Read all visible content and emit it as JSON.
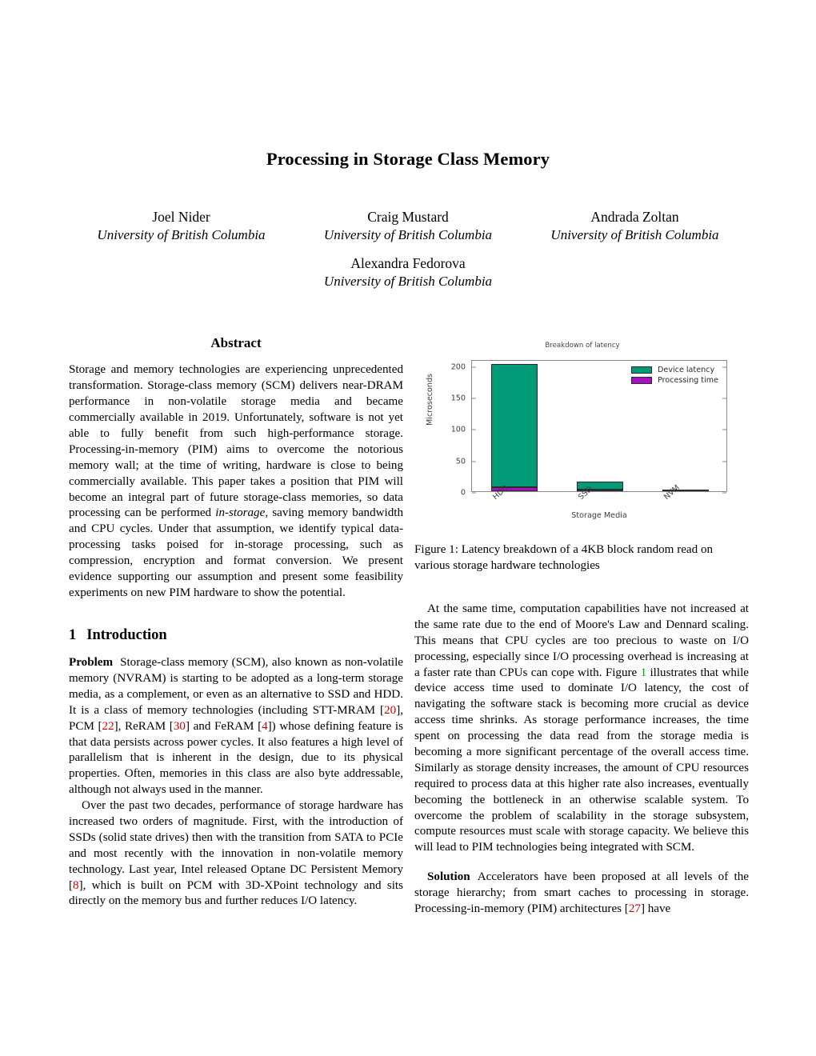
{
  "paper": {
    "title": "Processing in Storage Class Memory",
    "authors": [
      {
        "name": "Joel Nider",
        "affiliation": "University of British Columbia"
      },
      {
        "name": "Craig Mustard",
        "affiliation": "University of British Columbia"
      },
      {
        "name": "Andrada Zoltan",
        "affiliation": "University of British Columbia"
      },
      {
        "name": "Alexandra Fedorova",
        "affiliation": "University of British Columbia"
      }
    ]
  },
  "abstract": {
    "heading": "Abstract",
    "text_part1": "Storage and memory technologies are experiencing unprecedented transformation. Storage-class memory (SCM) delivers near-DRAM performance in non-volatile storage media and became commercially available in 2019. Unfortunately, software is not yet able to fully benefit from such high-performance storage. Processing-in-memory (PIM) aims to overcome the notorious memory wall; at the time of writing, hardware is close to being commercially available. This paper takes a position that PIM will become an integral part of future storage-class memories, so data processing can be performed ",
    "emphasis": "in-storage",
    "text_part2": ", saving memory bandwidth and CPU cycles. Under that assumption, we identify typical data-processing tasks poised for in-storage processing, such as compression, encryption and format conversion. We present evidence supporting our assumption and present some feasibility experiments on new PIM hardware to show the potential."
  },
  "introduction": {
    "number": "1",
    "heading": "Introduction",
    "problem": {
      "runin": "Problem",
      "t1": "Storage-class memory (SCM), also known as non-volatile memory (NVRAM) is starting to be adopted as a long-term storage media, as a complement, or even as an alternative to SSD and HDD. It is a class of memory technologies (including STT-MRAM [",
      "c1": "20",
      "t2": "], PCM [",
      "c2": "22",
      "t3": "], ReRAM [",
      "c3": "30",
      "t4": "] and FeRAM [",
      "c4": "4",
      "t5": "]) whose defining feature is that data persists across power cycles. It also features a high level of parallelism that is inherent in the design, due to its physical properties. Often, memories in this class are also byte addressable, although not always used in the manner."
    },
    "paragraph2": {
      "t1": "Over the past two decades, performance of storage hardware has increased two orders of magnitude. First, with the introduction of SSDs (solid state drives) then with the transition from SATA to PCIe and most recently with the innovation in non-volatile memory technology. Last year, Intel released Optane DC Persistent Memory [",
      "c1": "8",
      "t2": "], which is built on PCM with 3D-XPoint technology and sits directly on the memory bus and further reduces I/O latency."
    }
  },
  "right_column": {
    "figure_caption": "Figure 1: Latency breakdown of a 4KB block random read on various storage hardware technologies",
    "paragraph1": {
      "t1": "At the same time, computation capabilities have not increased at the same rate due to the end of Moore's Law and Dennard scaling. This means that CPU cycles are too precious to waste on I/O processing, especially since I/O processing overhead is increasing at a faster rate than CPUs can cope with. Figure ",
      "ref": "1",
      "t2": " illustrates that while device access time used to dominate I/O latency, the cost of navigating the software stack is becoming more crucial as device access time shrinks. As storage performance increases, the time spent on processing the data read from the storage media is becoming a more significant percentage of the overall access time. Similarly as storage density increases, the amount of CPU resources required to process data at this higher rate also increases, eventually becoming the bottleneck in an otherwise scalable system. To overcome the problem of scalability in the storage subsystem, compute resources must scale with storage capacity. We believe this will lead to PIM technologies being integrated with SCM."
    },
    "solution": {
      "runin": "Solution",
      "t1": "Accelerators have been proposed at all levels of the storage hierarchy; from smart caches to processing in storage. Processing-in-memory (PIM) architectures [",
      "c1": "27",
      "t2": "] have"
    }
  },
  "chart_data": {
    "type": "bar",
    "title": "Breakdown of latency",
    "xlabel": "Storage Media",
    "ylabel": "Microseconds",
    "categories": [
      "HDD",
      "SSD",
      "NVM"
    ],
    "ylim": [
      0,
      210
    ],
    "yticks": [
      0,
      50,
      100,
      150,
      200
    ],
    "ytick_labels": [
      "0",
      "50",
      "100",
      "150",
      "200"
    ],
    "stacked": true,
    "grid": false,
    "legend_position": "top-right",
    "series": [
      {
        "name": "Device latency",
        "color": "#009b76",
        "values": [
          195,
          12,
          0.4
        ]
      },
      {
        "name": "Processing time",
        "color": "#a80ec4",
        "values": [
          7,
          3,
          3
        ]
      }
    ],
    "totals": [
      202,
      15,
      3.4
    ]
  }
}
